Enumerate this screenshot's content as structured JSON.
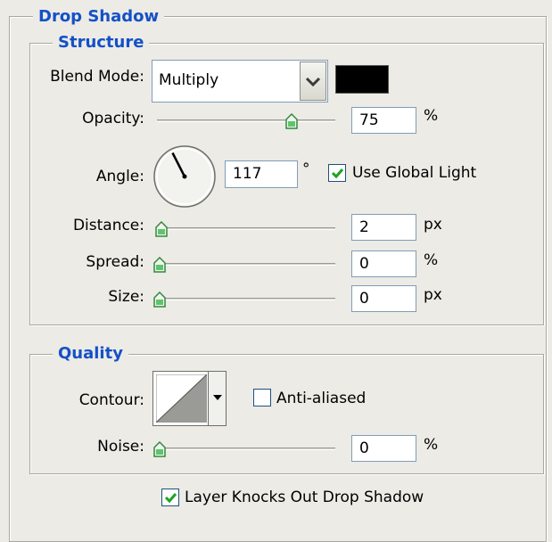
{
  "panel": {
    "title": "Drop Shadow",
    "structure": {
      "title": "Structure",
      "blend_mode": {
        "label": "Blend Mode:",
        "value": "Multiply",
        "color": "#000000"
      },
      "opacity": {
        "label": "Opacity:",
        "value": "75",
        "unit": "%",
        "level": 0.75
      },
      "angle": {
        "label": "Angle:",
        "value": "117",
        "unit": "°",
        "degrees": 117
      },
      "use_global_light": {
        "label": "Use Global Light",
        "checked": true
      },
      "distance": {
        "label": "Distance:",
        "value": "2",
        "unit": "px",
        "level": 0.0
      },
      "spread": {
        "label": "Spread:",
        "value": "0",
        "unit": "%",
        "level": 0.0
      },
      "size": {
        "label": "Size:",
        "value": "0",
        "unit": "px",
        "level": 0.0
      }
    },
    "quality": {
      "title": "Quality",
      "contour": {
        "label": "Contour:"
      },
      "anti_aliased": {
        "label": "Anti-aliased",
        "checked": false
      },
      "noise": {
        "label": "Noise:",
        "value": "0",
        "unit": "%",
        "level": 0.0
      }
    },
    "layer_knocks_out": {
      "label": "Layer Knocks Out Drop Shadow",
      "checked": true
    }
  },
  "colors": {
    "background": "#ecebe5",
    "legend_text": "#1450c8",
    "check_mark": "#21a121",
    "thumb": "#2ea34a"
  }
}
